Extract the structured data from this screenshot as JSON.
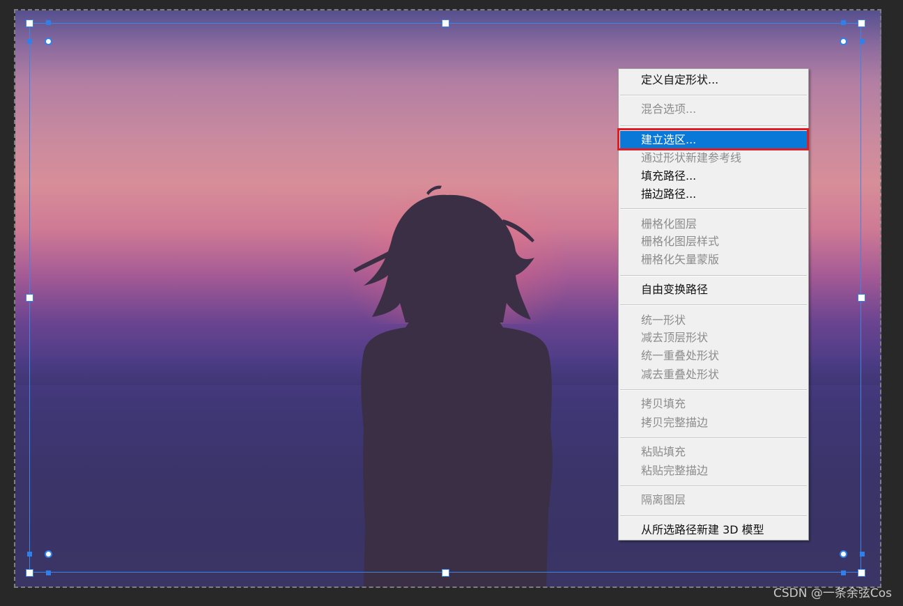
{
  "canvas": {
    "photo_subject": "silhouette of a woman facing a purple sunset over the sea"
  },
  "context_menu": {
    "items": [
      {
        "label": "定义自定形状...",
        "enabled": true,
        "highlighted": false
      },
      {
        "label": "混合选项...",
        "enabled": false,
        "highlighted": false
      },
      {
        "label": "建立选区...",
        "enabled": true,
        "highlighted": true
      },
      {
        "label": "通过形状新建参考线",
        "enabled": false,
        "highlighted": false
      },
      {
        "label": "填充路径...",
        "enabled": true,
        "highlighted": false
      },
      {
        "label": "描边路径...",
        "enabled": true,
        "highlighted": false
      },
      {
        "label": "栅格化图层",
        "enabled": false,
        "highlighted": false
      },
      {
        "label": "栅格化图层样式",
        "enabled": false,
        "highlighted": false
      },
      {
        "label": "栅格化矢量蒙版",
        "enabled": false,
        "highlighted": false
      },
      {
        "label": "自由变换路径",
        "enabled": true,
        "highlighted": false
      },
      {
        "label": "统一形状",
        "enabled": false,
        "highlighted": false
      },
      {
        "label": "减去顶层形状",
        "enabled": false,
        "highlighted": false
      },
      {
        "label": "统一重叠处形状",
        "enabled": false,
        "highlighted": false
      },
      {
        "label": "减去重叠处形状",
        "enabled": false,
        "highlighted": false
      },
      {
        "label": "拷贝填充",
        "enabled": false,
        "highlighted": false
      },
      {
        "label": "拷贝完整描边",
        "enabled": false,
        "highlighted": false
      },
      {
        "label": "粘贴填充",
        "enabled": false,
        "highlighted": false
      },
      {
        "label": "粘贴完整描边",
        "enabled": false,
        "highlighted": false
      },
      {
        "label": "隔离图层",
        "enabled": false,
        "highlighted": false
      },
      {
        "label": "从所选路径新建 3D 模型",
        "enabled": true,
        "highlighted": false
      }
    ]
  },
  "colors": {
    "highlight": "#0a78d7",
    "annotation": "#e11b22",
    "path_outline": "#3a86e8"
  },
  "watermark": "CSDN @一条余弦Cos"
}
